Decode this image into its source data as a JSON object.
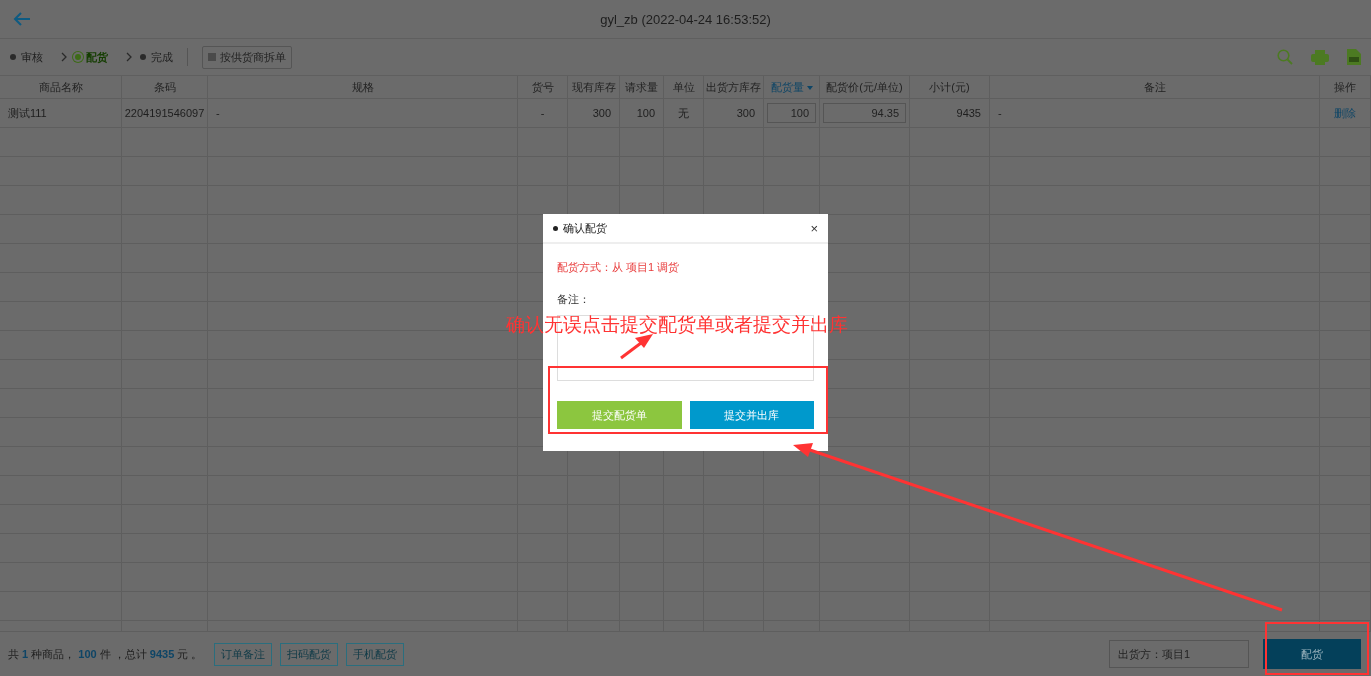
{
  "header": {
    "title": "gyl_zb   (2022-04-24 16:53:52)"
  },
  "steps": [
    {
      "label": "审核",
      "selected": false
    },
    {
      "label": "配货",
      "selected": true
    },
    {
      "label": "完成",
      "selected": false
    }
  ],
  "split_option": {
    "label": "按供货商拆单",
    "checked": false
  },
  "table": {
    "columns": [
      {
        "label": "商品名称",
        "kind": "plain"
      },
      {
        "label": "条码",
        "kind": "plain"
      },
      {
        "label": "规格",
        "kind": "plain"
      },
      {
        "label": "货号",
        "kind": "plain"
      },
      {
        "label": "现有库存",
        "kind": "plain"
      },
      {
        "label": "请求量",
        "kind": "plain"
      },
      {
        "label": "单位",
        "kind": "plain"
      },
      {
        "label": "出货方库存",
        "kind": "plain"
      },
      {
        "label": "配货量",
        "kind": "sort"
      },
      {
        "label": "配货价(元/单位)",
        "kind": "plain"
      },
      {
        "label": "小计(元)",
        "kind": "plain"
      },
      {
        "label": "备注",
        "kind": "plain"
      },
      {
        "label": "操作",
        "kind": "plain"
      }
    ],
    "rows": [
      {
        "cells": [
          "测试111",
          "2204191546097",
          "-",
          "-",
          "300",
          "100",
          "无",
          "300",
          "100",
          "94.35",
          "9435",
          "-",
          "删除"
        ]
      }
    ]
  },
  "footer": {
    "summary": "共 **1** 种商品， **100** 件 ，总计 **9435** 元 。",
    "buttons": [
      "订单备注",
      "扫码配货",
      "手机配货"
    ],
    "source_field": "出货方：项目1",
    "submit_button": "配货"
  },
  "dialog": {
    "title": "确认配货",
    "close": "×",
    "method": "配货方式：从 项目1 调货",
    "note_label": "备注：",
    "buttons": [
      {
        "label": "提交配货单",
        "kind": "green"
      },
      {
        "label": "提交并出库",
        "kind": "blue"
      }
    ]
  },
  "annotation": {
    "text": "确认无误点击提交配货单或者提交并出库"
  }
}
